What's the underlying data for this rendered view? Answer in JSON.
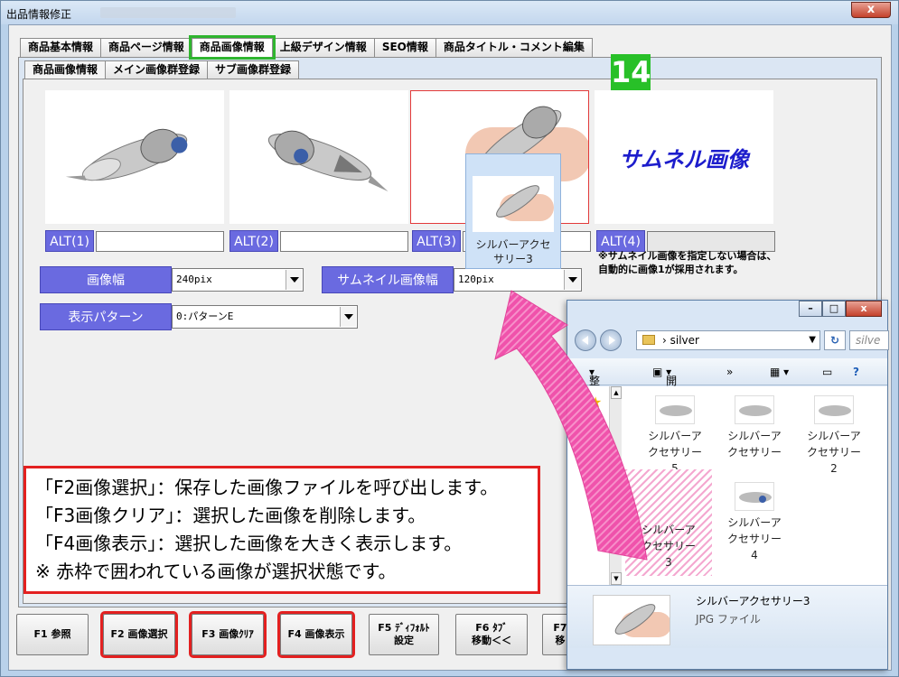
{
  "window": {
    "title": "出品情報修正",
    "close_label": "x"
  },
  "main_tabs": [
    "商品基本情報",
    "商品ページ情報",
    "商品画像情報",
    "上級デザイン情報",
    "SEO情報",
    "商品タイトル・コメント編集"
  ],
  "sub_tabs": [
    "商品画像情報",
    "メイン画像群登録",
    "サブ画像群登録"
  ],
  "thumbnail_text": "サムネル画像",
  "badge": "14",
  "alt_labels": [
    "ALT(1)",
    "ALT(2)",
    "ALT(3)",
    "ALT(4)"
  ],
  "settings": {
    "image_width_label": "画像幅",
    "image_width_value": "240pix",
    "thumb_width_label": "サムネイル画像幅",
    "thumb_width_value": "120pix",
    "pattern_label": "表示パターン",
    "pattern_value": "0:パターンE",
    "note_line1": "※サムネイル画像を指定しない場合は、",
    "note_line2": "自動的に画像1が採用されます。"
  },
  "drag_tooltip": {
    "line1": "シルバーアクセ",
    "line2": "サリー3"
  },
  "callout": [
    "「F2画像選択」：保存した画像ファイルを呼び出します。",
    "「F3画像クリア」：選択した画像を削除します。",
    "「F4画像表示」：選択した画像を大きく表示します。",
    "※ 赤枠で囲われている画像が選択状態です。"
  ],
  "function_buttons": [
    {
      "label": "F1 参照"
    },
    {
      "label": "F2 画像選択"
    },
    {
      "label": "F3 画像ｸﾘｱ"
    },
    {
      "label": "F4 画像表示"
    },
    {
      "label": "F5 ﾃﾞｨﾌｫﾙﾄ\n設定"
    },
    {
      "label": "F6 ﾀﾌﾞ\n移動＜＜"
    },
    {
      "label": "F7\n移"
    }
  ],
  "explorer": {
    "address": "silver",
    "search_placeholder": "silve",
    "organize": "整理",
    "open": "開く",
    "more": "»",
    "files": [
      {
        "name": "シルバーア\nクセサリー\n5"
      },
      {
        "name": "シルバーア\nクセサリー"
      },
      {
        "name": "シルバーア\nクセサリー\n2"
      },
      {
        "name": "シルバーア\nクセサリー\n3"
      },
      {
        "name": "シルバーア\nクセサリー\n4"
      }
    ],
    "selected_name": "シルバーアクセサリー3",
    "selected_type": "JPG ファイル"
  },
  "colors": {
    "accent_purple": "#6a6ae0",
    "highlight_red": "#e32020",
    "tab_green": "#2fb52f",
    "arrow_pink": "#f04aa8"
  }
}
